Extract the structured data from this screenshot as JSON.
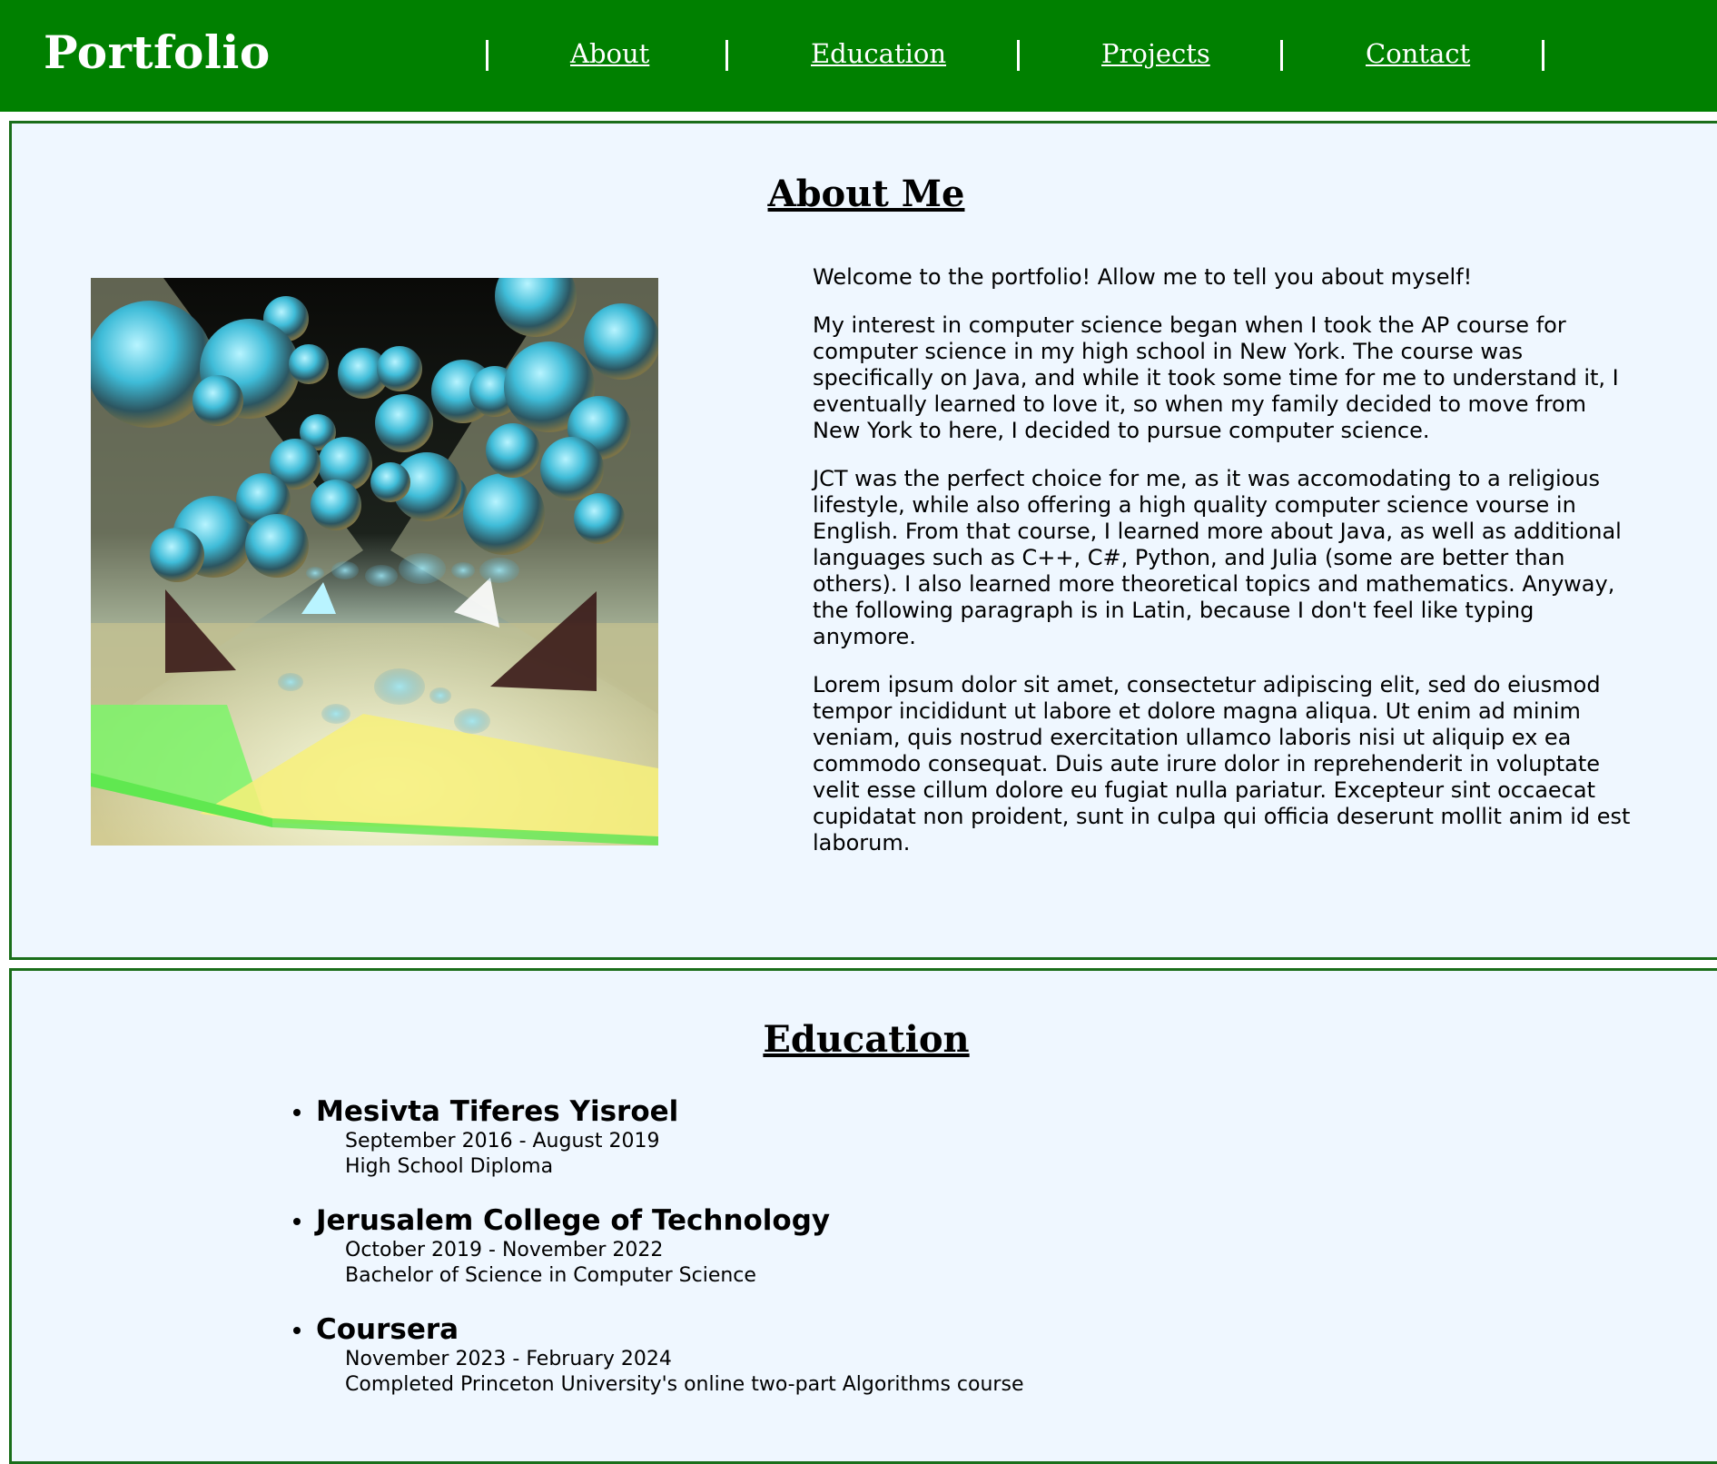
{
  "header": {
    "brand": "Portfolio",
    "nav": [
      {
        "label": "About"
      },
      {
        "label": "Education"
      },
      {
        "label": "Projects"
      },
      {
        "label": "Contact"
      }
    ],
    "separator": "|",
    "background_color": "#008000"
  },
  "about": {
    "title": "About Me",
    "image_icon": "raytraced-spheres-render",
    "paragraphs": [
      "Welcome to the portfolio! Allow me to tell you about myself!",
      "My interest in computer science began when I took the AP course for computer science in my high school in New York. The course was specifically on Java, and while it took some time for me to understand it, I eventually learned to love it, so when my family decided to move from New York to here, I decided to pursue computer science.",
      "JCT was the perfect choice for me, as it was accomodating to a religious lifestyle, while also offering a high quality computer science vourse in English. From that course, I learned more about Java, as well as additional languages such as C++, C#, Python, and Julia (some are better than others). I also learned more theoretical topics and mathematics. Anyway, the following paragraph is in Latin, because I don't feel like typing anymore.",
      "Lorem ipsum dolor sit amet, consectetur adipiscing elit, sed do eiusmod tempor incididunt ut labore et dolore magna aliqua. Ut enim ad minim veniam, quis nostrud exercitation ullamco laboris nisi ut aliquip ex ea commodo consequat. Duis aute irure dolor in reprehenderit in voluptate velit esse cillum dolore eu fugiat nulla pariatur. Excepteur sint occaecat cupidatat non proident, sunt in culpa qui officia deserunt mollit anim id est laborum."
    ]
  },
  "education": {
    "title": "Education",
    "items": [
      {
        "name": "Mesivta Tiferes Yisroel",
        "dates": "September 2016 - August 2019",
        "degree": "High School Diploma"
      },
      {
        "name": "Jerusalem College of Technology",
        "dates": "October 2019 - November 2022",
        "degree": "Bachelor of Science in Computer Science"
      },
      {
        "name": "Coursera",
        "dates": "November 2023 - February 2024",
        "degree": "Completed Princeton University's online two-part Algorithms course"
      }
    ]
  },
  "colors": {
    "header_bg": "#008000",
    "section_bg": "#eff7ff",
    "section_border": "#1a6e1a"
  }
}
